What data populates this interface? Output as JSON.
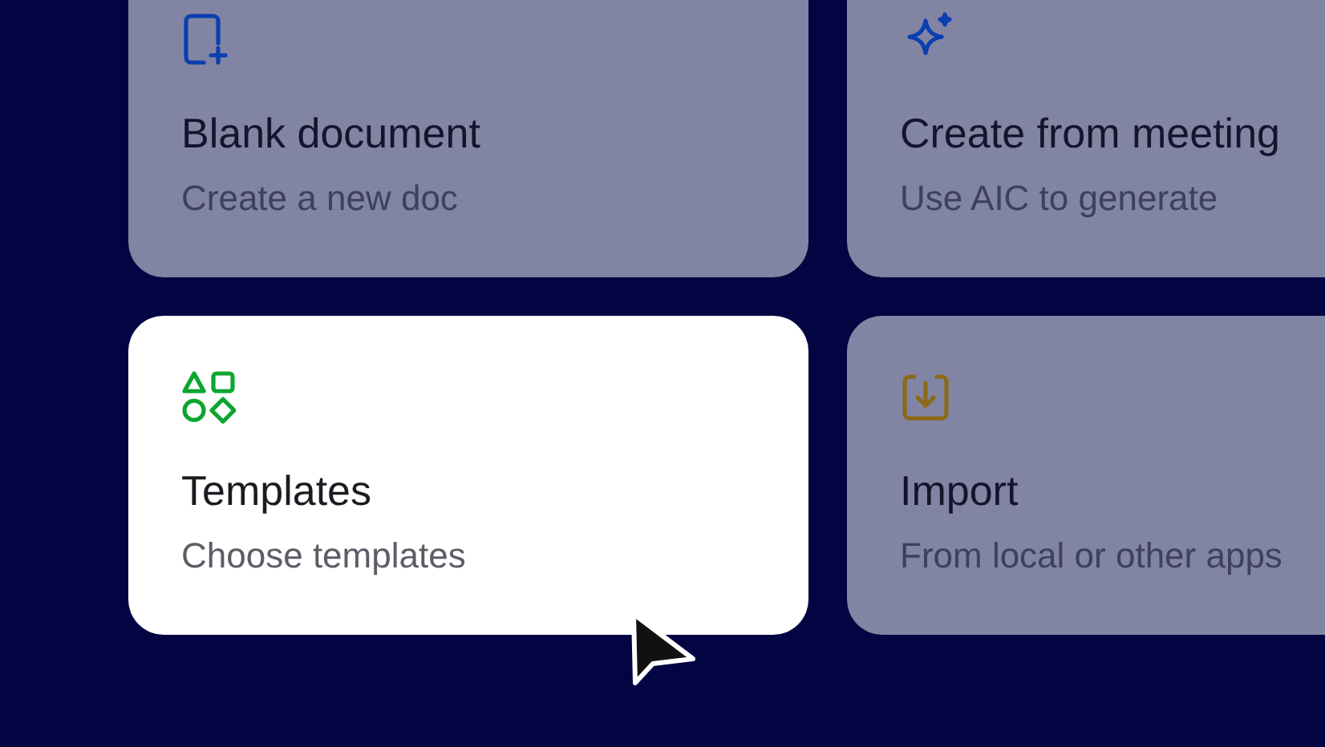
{
  "cards": [
    {
      "kind": "blank",
      "title": "Blank document",
      "subtitle": "Create a new doc",
      "selected": false
    },
    {
      "kind": "ai",
      "title": "Create from meeting",
      "subtitle": "Use AIC to generate",
      "selected": false
    },
    {
      "kind": "templates",
      "title": "Templates",
      "subtitle": "Choose templates",
      "selected": true
    },
    {
      "kind": "import",
      "title": "Import",
      "subtitle": "From local or other apps",
      "selected": false
    }
  ]
}
